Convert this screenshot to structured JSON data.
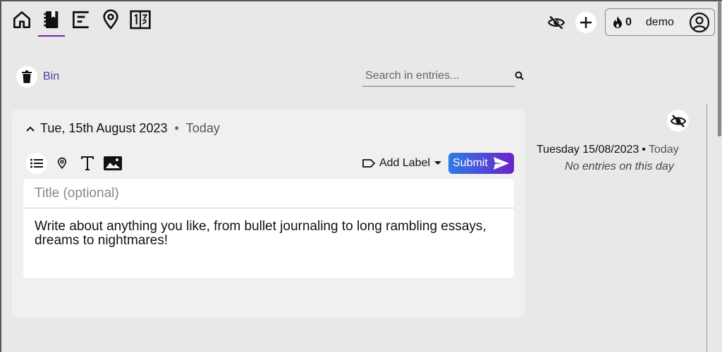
{
  "nav": {
    "items": [
      {
        "icon": "home-icon"
      },
      {
        "icon": "journal-icon",
        "active": true
      },
      {
        "icon": "timeline-icon"
      },
      {
        "icon": "map-pin-icon"
      },
      {
        "icon": "calendar-icon"
      }
    ]
  },
  "header": {
    "streak_count": "0",
    "username": "demo"
  },
  "bin": {
    "label": "Bin"
  },
  "search": {
    "placeholder": "Search in entries..."
  },
  "entry_card": {
    "date": "Tue, 15th August 2023",
    "separator": "•",
    "relative": "Today",
    "add_label": "Add Label",
    "submit": "Submit",
    "title_placeholder": "Title (optional)",
    "body_text": "Write about anything you like, from bullet journaling to long rambling essays, dreams to nightmares!"
  },
  "side_panel": {
    "date": "Tuesday 15/08/2023",
    "separator": "•",
    "relative": "Today",
    "empty_message": "No entries on this day"
  },
  "colors": {
    "accent_purple": "#7b1fa2",
    "bin_link": "#4a3ea8",
    "submit_gradient_start": "#2d7be6",
    "submit_gradient_end": "#6d22c9"
  }
}
